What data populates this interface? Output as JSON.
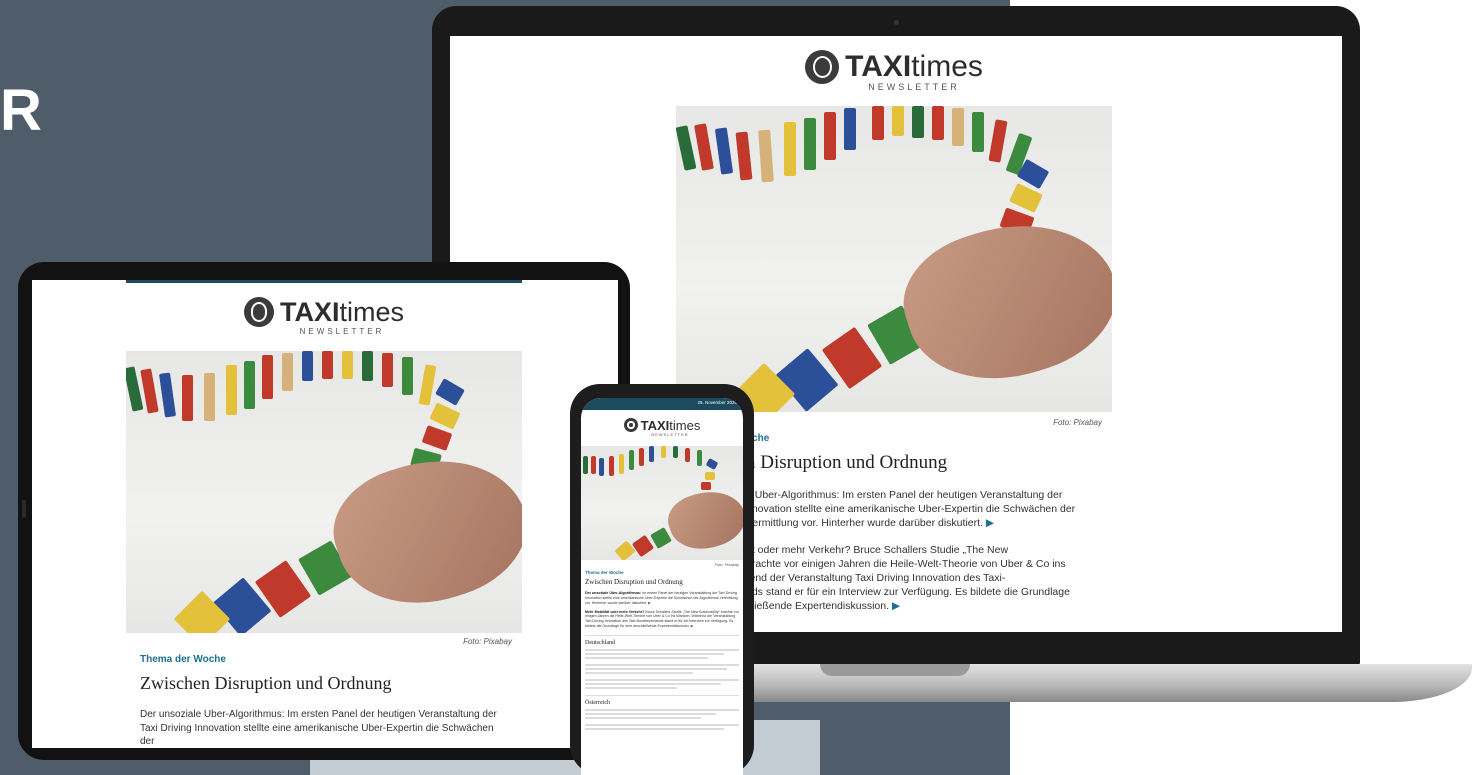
{
  "hero": {
    "letter": "R"
  },
  "newsletter": {
    "brand_bold": "TAXI",
    "brand_light": "times",
    "brand_sub": "NEWSLETTER",
    "date": "25. November 2020",
    "photo_credit": "Foto: Pixabay",
    "kicker": "Thema der Woche",
    "headline": "Zwischen Disruption und Ordnung",
    "items": [
      {
        "lead": "Der unsoziale Uber-Algorithmus:",
        "text": "Im ersten Panel der heutigen Veranstaltung der Taxi Driving Innovation stellte eine amerikanische Uber-Expertin die Schwächen der Algorithmus-Vermittlung vor. Hinterher wurde darüber diskutiert."
      },
      {
        "lead": "Mehr Mobilität oder mehr Verkehr?",
        "text": "Bruce Schallers Studie „The New Automobility“ brachte vor einigen Jahren die Heile-Welt-Theorie von Uber & Co ins Wanken. Während der Veranstaltung Taxi Driving Innovation des Taxi-Bundesverbands stand er für ein Interview zur Verfügung. Es bildete die Grundlage für eine anschließende Expertendiskussion."
      }
    ],
    "laptop_cut": {
      "kicker": "oche",
      "headline": "n Disruption und Ordnung",
      "lines1": [
        "e Uber-Algorithmus: Im ersten Panel der heutigen Veranstaltung der",
        "nnovation stellte eine amerikanische Uber-Expertin die Schwächen der",
        "Vermittlung vor. Hinterher wurde darüber diskutiert."
      ],
      "lines2": [
        "ät oder mehr Verkehr? Bruce Schallers Studie „The New",
        " brachte vor einigen Jahren die Heile-Welt-Theorie von Uber & Co ins",
        "rend der Veranstaltung Taxi Driving Innovation des Taxi-",
        "nds stand er für ein Interview zur Verfügung. Es bildete die Grundlage",
        "hließende Expertendiskussion."
      ]
    },
    "tablet_lines": [
      "Der unsoziale Uber-Algorithmus: Im ersten Panel der heutigen Veranstaltung der",
      "Taxi Driving Innovation stellte eine amerikanische Uber-Expertin die Schwächen der"
    ],
    "sections": [
      "Deutschland",
      "Österreich"
    ]
  }
}
